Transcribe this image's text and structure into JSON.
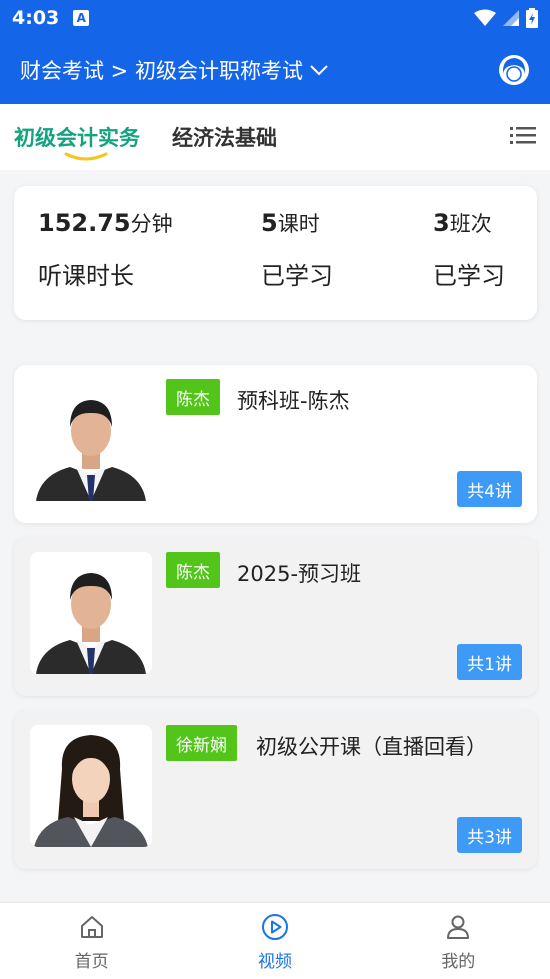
{
  "status_bar": {
    "time": "4:03",
    "notification_badge": "A"
  },
  "header": {
    "breadcrumb": "财会考试 > 初级会计职称考试",
    "avatar_icon": "user-avatar-icon"
  },
  "tabs": [
    {
      "label": "初级会计实务",
      "active": true
    },
    {
      "label": "经济法基础",
      "active": false
    }
  ],
  "stats": [
    {
      "value": "152.75",
      "unit": "分钟",
      "label": "听课时长"
    },
    {
      "value": "5",
      "unit": "课时",
      "label": "已学习"
    },
    {
      "value": "3",
      "unit": "班次",
      "label": "已学习"
    }
  ],
  "courses": [
    {
      "teacher": "陈杰",
      "title": "预科班-陈杰",
      "lessons": "共4讲"
    },
    {
      "teacher": "陈杰",
      "title": "2025-预习班",
      "lessons": "共1讲"
    },
    {
      "teacher": "徐新娴",
      "title": "初级公开课（直播回看）",
      "lessons": "共3讲"
    }
  ],
  "bottom_nav": [
    {
      "label": "首页",
      "icon": "home-icon",
      "active": false
    },
    {
      "label": "视频",
      "icon": "play-icon",
      "active": true
    },
    {
      "label": "我的",
      "icon": "profile-icon",
      "active": false
    }
  ],
  "colors": {
    "primary": "#1565e8",
    "tab_active": "#14a37f",
    "tag_green": "#52c41a",
    "badge_blue": "#3d9bf7",
    "nav_active": "#1a73e8"
  }
}
